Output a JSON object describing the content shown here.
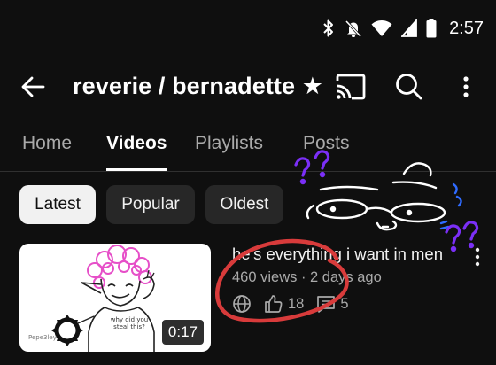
{
  "status_bar": {
    "time": "2:57",
    "icons": [
      "bluetooth-icon",
      "notifications-off-icon",
      "wifi-icon",
      "cellular-signal-icon",
      "battery-icon"
    ]
  },
  "app_bar": {
    "title": "reverie / bernadette ★",
    "icons": [
      "back-arrow-icon",
      "cast-icon",
      "search-icon",
      "more-vert-icon"
    ]
  },
  "tabs": [
    {
      "label": "Home",
      "active": false
    },
    {
      "label": "Videos",
      "active": true
    },
    {
      "label": "Playlists",
      "active": false
    },
    {
      "label": "Posts",
      "active": false
    }
  ],
  "chips": [
    {
      "label": "Latest",
      "selected": true
    },
    {
      "label": "Popular",
      "selected": false
    },
    {
      "label": "Oldest",
      "selected": false
    }
  ],
  "video": {
    "title": "he's everything i want in men",
    "meta": "460 views · 2 days ago",
    "duration": "0:17",
    "likes": "18",
    "comments": "5",
    "thumbnail_caption": "why did you steal this?",
    "thumbnail_signature": "Pepe3ley"
  },
  "colors": {
    "background": "#0f0f0f",
    "primary_text": "#f1f1f1",
    "secondary_text": "#aaaaaa",
    "chip_bg": "#272727",
    "chip_selected_bg": "#f1f1f1",
    "doodle_purple": "#7b2ff7",
    "doodle_blue": "#2f6bff",
    "circle_red": "#d83b3b"
  }
}
